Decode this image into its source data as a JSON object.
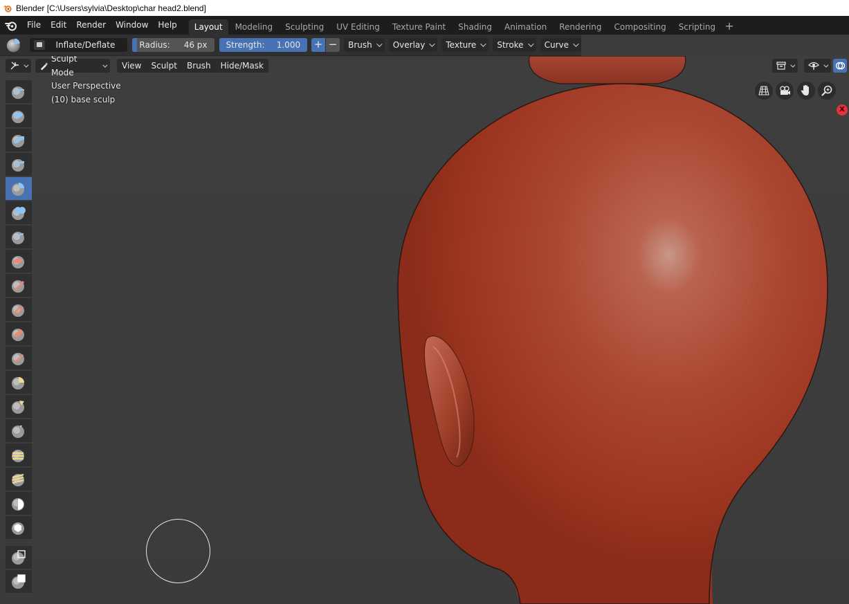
{
  "window": {
    "title": "Blender [C:\\Users\\sylvia\\Desktop\\char head2.blend]"
  },
  "menu": {
    "items": [
      "File",
      "Edit",
      "Render",
      "Window",
      "Help"
    ]
  },
  "workspaces": {
    "tabs": [
      "Layout",
      "Modeling",
      "Sculpting",
      "UV Editing",
      "Texture Paint",
      "Shading",
      "Animation",
      "Rendering",
      "Compositing",
      "Scripting"
    ],
    "active": "Layout",
    "add_label": "+"
  },
  "tool_settings": {
    "brush_name": "Inflate/Deflate",
    "radius_label": "Radius:",
    "radius_value": "46 px",
    "radius_fill_fraction": 0.06,
    "strength_label": "Strength:",
    "strength_value": "1.000",
    "strength_fill_fraction": 1.0,
    "plus_label": "+",
    "minus_label": "−",
    "dropdowns": [
      "Brush",
      "Overlay",
      "Texture",
      "Stroke",
      "Curve"
    ]
  },
  "viewport_header": {
    "mode": "Sculpt Mode",
    "menus": [
      "View",
      "Sculpt",
      "Brush",
      "Hide/Mask"
    ]
  },
  "viewport": {
    "perspective": "User Perspective",
    "object_info": "(10) base sculp",
    "axis_label": "X"
  },
  "toolbar": {
    "tools": [
      "draw-brush",
      "draw-sharp-brush",
      "clay-brush",
      "clay-strips-brush",
      "inflate-brush",
      "blob-brush",
      "crease-brush",
      "smooth-brush",
      "flatten-brush",
      "fill-brush",
      "scrape-brush",
      "pinch-brush",
      "grab-brush",
      "snake-hook-brush",
      "thumb-brush",
      "nudge-brush",
      "rotate-brush",
      "mask-brush",
      "draw-face-sets-brush",
      "box-mask-tool",
      "box-hide-tool"
    ],
    "active_index": 4
  },
  "colors": {
    "accent": "#4772b3",
    "skin": "#b4442f",
    "background": "#3d3d3d"
  }
}
